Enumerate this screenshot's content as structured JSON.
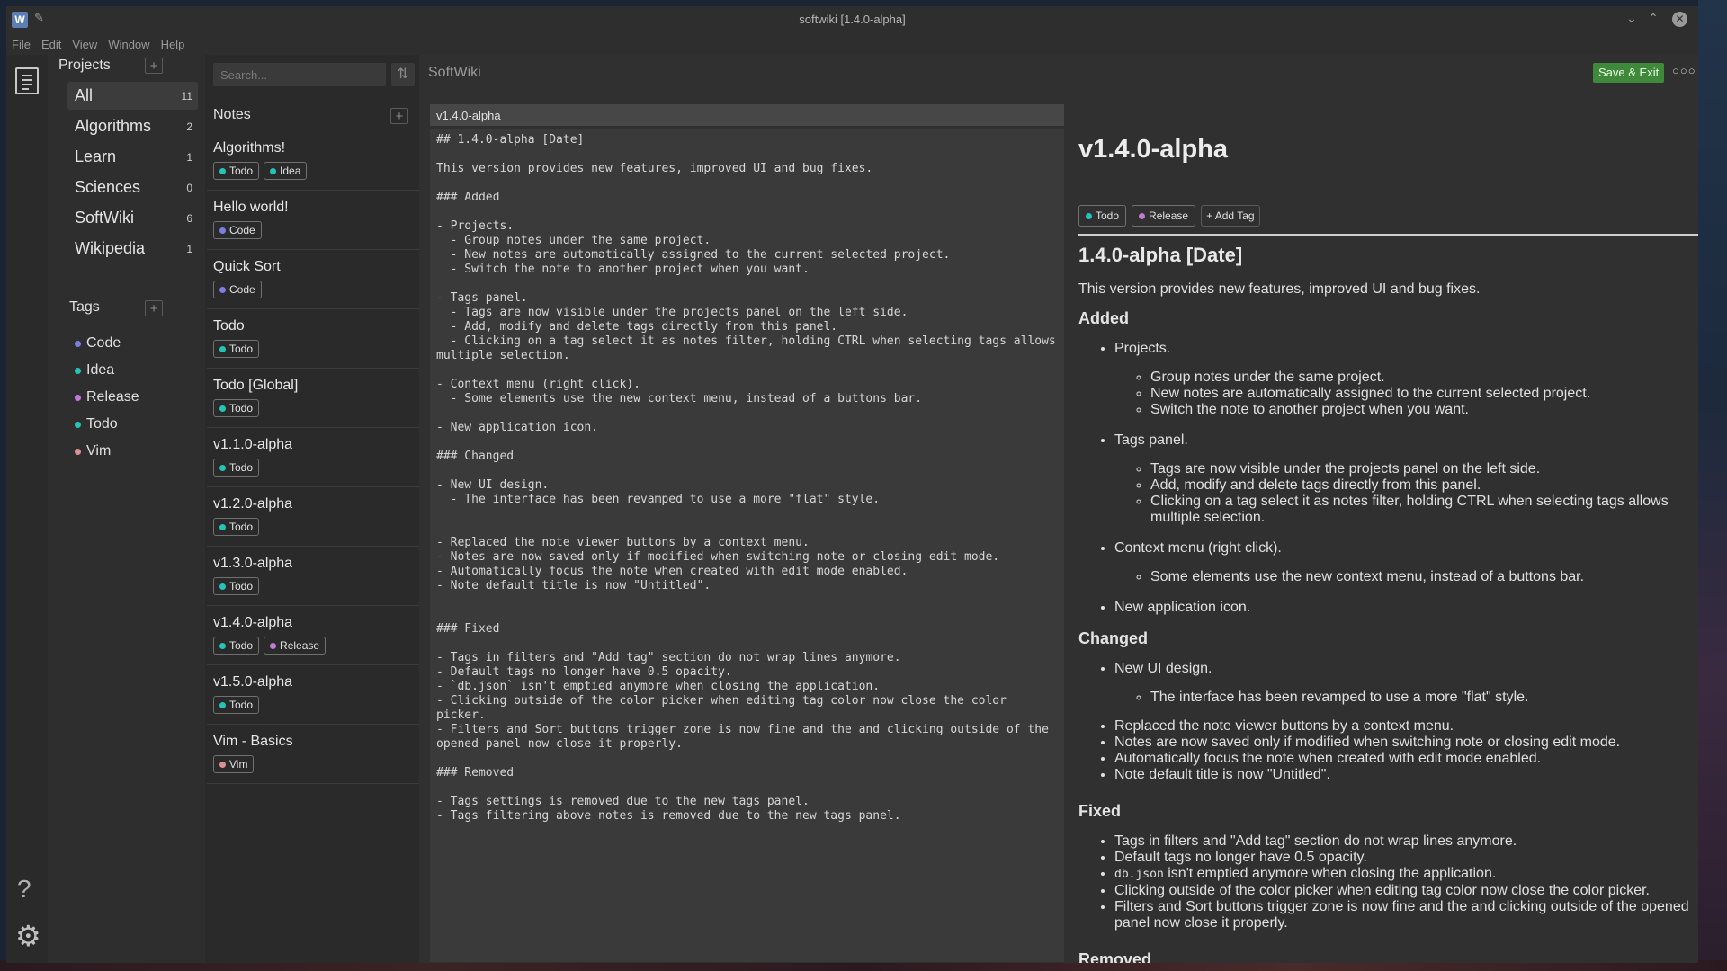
{
  "window": {
    "title": "softwiki [1.4.0-alpha]",
    "app_icon_letter": "W",
    "menu": [
      "File",
      "Edit",
      "View",
      "Window",
      "Help"
    ]
  },
  "colors": {
    "accent_green": "#3f8a3a",
    "tag_code": "#7b7fe0",
    "tag_idea": "#25c4b8",
    "tag_release": "#c07ad6",
    "tag_todo": "#25c4b8",
    "tag_vim": "#d99090"
  },
  "icons": {
    "rail_top": "notes-icon",
    "rail_help": "help-icon",
    "rail_settings": "gear-icon",
    "sort": "sort-icon"
  },
  "projects": {
    "header": "Projects",
    "add": "+",
    "items": [
      {
        "name": "All",
        "count": "11"
      },
      {
        "name": "Algorithms",
        "count": "2"
      },
      {
        "name": "Learn",
        "count": "1"
      },
      {
        "name": "Sciences",
        "count": "0"
      },
      {
        "name": "SoftWiki",
        "count": "6"
      },
      {
        "name": "Wikipedia",
        "count": "1"
      }
    ]
  },
  "tags": {
    "header": "Tags",
    "add": "+",
    "items": [
      {
        "name": "Code",
        "color": "#7b7fe0"
      },
      {
        "name": "Idea",
        "color": "#25c4b8"
      },
      {
        "name": "Release",
        "color": "#c07ad6"
      },
      {
        "name": "Todo",
        "color": "#25c4b8"
      },
      {
        "name": "Vim",
        "color": "#d99090"
      }
    ]
  },
  "notes": {
    "search_placeholder": "Search...",
    "header": "Notes",
    "add": "+",
    "items": [
      {
        "title": "Algorithms!",
        "tags": [
          {
            "label": "Todo",
            "color": "#25c4b8"
          },
          {
            "label": "Idea",
            "color": "#25c4b8"
          }
        ]
      },
      {
        "title": "Hello world!",
        "tags": [
          {
            "label": "Code",
            "color": "#7b7fe0"
          }
        ]
      },
      {
        "title": "Quick Sort",
        "tags": [
          {
            "label": "Code",
            "color": "#7b7fe0"
          }
        ]
      },
      {
        "title": "Todo",
        "tags": [
          {
            "label": "Todo",
            "color": "#25c4b8"
          }
        ]
      },
      {
        "title": "Todo [Global]",
        "tags": [
          {
            "label": "Todo",
            "color": "#25c4b8"
          }
        ]
      },
      {
        "title": "v1.1.0-alpha",
        "tags": [
          {
            "label": "Todo",
            "color": "#25c4b8"
          }
        ]
      },
      {
        "title": "v1.2.0-alpha",
        "tags": [
          {
            "label": "Todo",
            "color": "#25c4b8"
          }
        ]
      },
      {
        "title": "v1.3.0-alpha",
        "tags": [
          {
            "label": "Todo",
            "color": "#25c4b8"
          }
        ]
      },
      {
        "title": "v1.4.0-alpha",
        "tags": [
          {
            "label": "Todo",
            "color": "#25c4b8"
          },
          {
            "label": "Release",
            "color": "#c07ad6"
          }
        ]
      },
      {
        "title": "v1.5.0-alpha",
        "tags": [
          {
            "label": "Todo",
            "color": "#25c4b8"
          }
        ]
      },
      {
        "title": "Vim - Basics",
        "tags": [
          {
            "label": "Vim",
            "color": "#d99090"
          }
        ]
      }
    ]
  },
  "editor": {
    "breadcrumb": "SoftWiki",
    "save_label": "Save & Exit",
    "more_label": "○○○",
    "title_value": "v1.4.0-alpha",
    "markdown": "## 1.4.0-alpha [Date]\n\nThis version provides new features, improved UI and bug fixes.\n\n### Added\n\n- Projects.\n  - Group notes under the same project.\n  - New notes are automatically assigned to the current selected project.\n  - Switch the note to another project when you want.\n\n- Tags panel.\n  - Tags are now visible under the projects panel on the left side.\n  - Add, modify and delete tags directly from this panel.\n  - Clicking on a tag select it as notes filter, holding CTRL when selecting tags allows multiple selection.\n\n- Context menu (right click).\n  - Some elements use the new context menu, instead of a buttons bar.\n\n- New application icon.\n\n### Changed\n\n- New UI design.\n  - The interface has been revamped to use a more \"flat\" style.\n\n\n- Replaced the note viewer buttons by a context menu.\n- Notes are now saved only if modified when switching note or closing edit mode.\n- Automatically focus the note when created with edit mode enabled.\n- Note default title is now \"Untitled\".\n\n\n### Fixed\n\n- Tags in filters and \"Add tag\" section do not wrap lines anymore.\n- Default tags no longer have 0.5 opacity.\n- `db.json` isn't emptied anymore when closing the application.\n- Clicking outside of the color picker when editing tag color now close the color picker.\n- Filters and Sort buttons trigger zone is now fine and the and clicking outside of the opened panel now close it properly.\n\n### Removed\n\n- Tags settings is removed due to the new tags panel.\n- Tags filtering above notes is removed due to the new tags panel."
  },
  "preview": {
    "title": "v1.4.0-alpha",
    "tags": [
      {
        "label": "Todo",
        "color": "#25c4b8"
      },
      {
        "label": "Release",
        "color": "#c07ad6"
      }
    ],
    "add_tag": "+ Add Tag",
    "h2": "1.4.0-alpha [Date]",
    "intro": "This version provides new features, improved UI and bug fixes.",
    "added_heading": "Added",
    "added_projects": "Projects.",
    "added_projects_sub": [
      "Group notes under the same project.",
      "New notes are automatically assigned to the current selected project.",
      "Switch the note to another project when you want."
    ],
    "added_tags": "Tags panel.",
    "added_tags_sub": [
      "Tags are now visible under the projects panel on the left side.",
      "Add, modify and delete tags directly from this panel.",
      "Clicking on a tag select it as notes filter, holding CTRL when selecting tags allows multiple selection."
    ],
    "added_context": "Context menu (right click).",
    "added_context_sub": [
      "Some elements use the new context menu, instead of a buttons bar."
    ],
    "added_icon": "New application icon.",
    "changed_heading": "Changed",
    "changed_ui": "New UI design.",
    "changed_ui_sub": [
      "The interface has been revamped to use a more \"flat\" style."
    ],
    "changed_list": [
      "Replaced the note viewer buttons by a context menu.",
      "Notes are now saved only if modified when switching note or closing edit mode.",
      "Automatically focus the note when created with edit mode enabled.",
      "Note default title is now \"Untitled\"."
    ],
    "fixed_heading": "Fixed",
    "fixed_1": "Tags in filters and \"Add tag\" section do not wrap lines anymore.",
    "fixed_2": "Default tags no longer have 0.5 opacity.",
    "fixed_3_code": "db.json",
    "fixed_3_rest": " isn't emptied anymore when closing the application.",
    "fixed_4": "Clicking outside of the color picker when editing tag color now close the color picker.",
    "fixed_5": "Filters and Sort buttons trigger zone is now fine and the and clicking outside of the opened panel now close it properly.",
    "removed_heading": "Removed"
  }
}
